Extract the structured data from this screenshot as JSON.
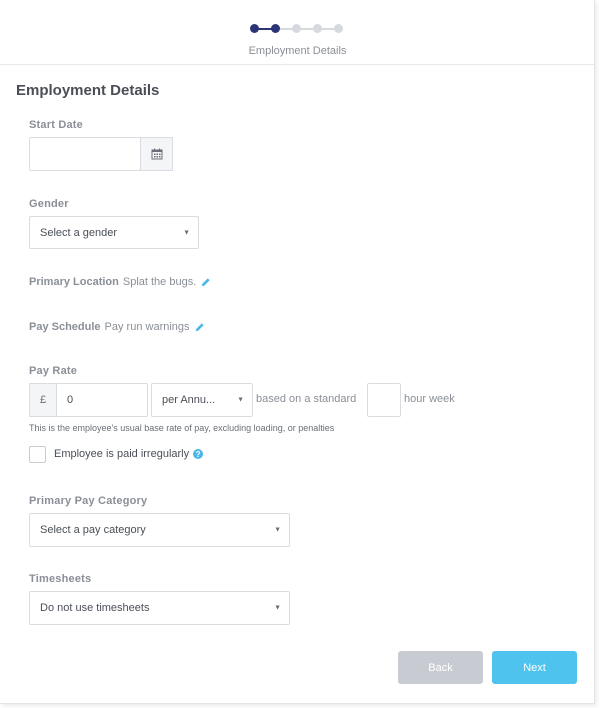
{
  "wizard": {
    "step_label": "Employment Details",
    "total_steps": 5,
    "current_step": 2
  },
  "form": {
    "title": "Employment Details",
    "start_date": {
      "label": "Start Date",
      "value": ""
    },
    "gender": {
      "label": "Gender",
      "selected": "Select a gender"
    },
    "primary_location": {
      "label": "Primary Location",
      "value": "Splat the bugs."
    },
    "pay_schedule": {
      "label": "Pay Schedule",
      "value": "Pay run warnings"
    },
    "pay_rate": {
      "label": "Pay Rate",
      "currency_symbol": "£",
      "value": "0",
      "period_selected": "per Annu...",
      "based_on_text": "based on a standard",
      "hours_value": "",
      "hour_week_text": "hour week",
      "helper": "This is the employee's usual base rate of pay, excluding loading, or penalties"
    },
    "paid_irregularly": {
      "label": "Employee is paid irregularly",
      "checked": false
    },
    "primary_pay_category": {
      "label": "Primary Pay Category",
      "selected": "Select a pay category"
    },
    "timesheets": {
      "label": "Timesheets",
      "selected": "Do not use timesheets"
    }
  },
  "buttons": {
    "back": "Back",
    "next": "Next"
  },
  "colors": {
    "accent": "#4ec3ee",
    "step_active": "#2b3576",
    "muted": "#c8ccd2"
  }
}
